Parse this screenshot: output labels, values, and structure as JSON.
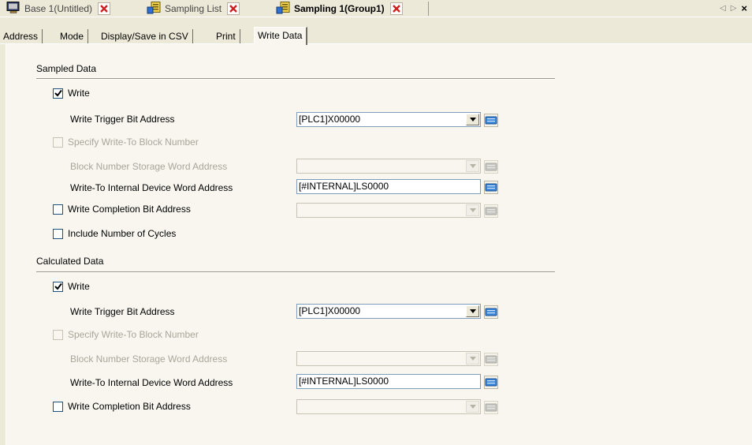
{
  "doc_tabs": [
    {
      "label": "Base 1(Untitled)",
      "icon": "screen-icon",
      "active": false
    },
    {
      "label": "Sampling List",
      "icon": "sampling-list-icon",
      "active": false
    },
    {
      "label": "Sampling 1(Group1)",
      "icon": "sampling-icon",
      "active": true
    }
  ],
  "nav": {
    "prev": "◁",
    "next": "▷",
    "close": "×"
  },
  "prop_tabs": [
    "Address",
    "Mode",
    "Display/Save in CSV",
    "Print",
    "Write Data"
  ],
  "active_prop_tab": "Write Data",
  "sampled": {
    "title": "Sampled Data",
    "write_label": "Write",
    "write_checked": true,
    "trigger_label": "Write Trigger Bit Address",
    "trigger_value": "[PLC1]X00000",
    "specify_label": "Specify Write-To Block Number",
    "block_storage_label": "Block Number Storage Word Address",
    "block_storage_value": "",
    "internal_label": "Write-To Internal Device Word Address",
    "internal_value": "[#INTERNAL]LS0000",
    "completion_label": "Write Completion Bit Address",
    "completion_checked": false,
    "completion_value": "",
    "cycles_label": "Include Number of Cycles",
    "cycles_checked": false
  },
  "calculated": {
    "title": "Calculated Data",
    "write_label": "Write",
    "write_checked": true,
    "trigger_label": "Write Trigger Bit Address",
    "trigger_value": "[PLC1]X00000",
    "specify_label": "Specify Write-To Block Number",
    "block_storage_label": "Block Number Storage Word Address",
    "block_storage_value": "",
    "internal_label": "Write-To Internal Device Word Address",
    "internal_value": "[#INTERNAL]LS0000",
    "completion_label": "Write Completion Bit Address",
    "completion_checked": false,
    "completion_value": ""
  },
  "colors": {
    "close_red": "#cc1f1f",
    "keyboard_blue": "#3a86d8",
    "disabled_text": "#a9a69a"
  }
}
